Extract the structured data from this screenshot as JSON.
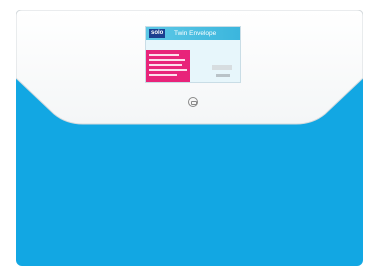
{
  "folder": {
    "body_color": "#12a7e3",
    "flap_color": "#ffffff"
  },
  "label": {
    "brand": "solo",
    "product": "Twin Envelope"
  }
}
